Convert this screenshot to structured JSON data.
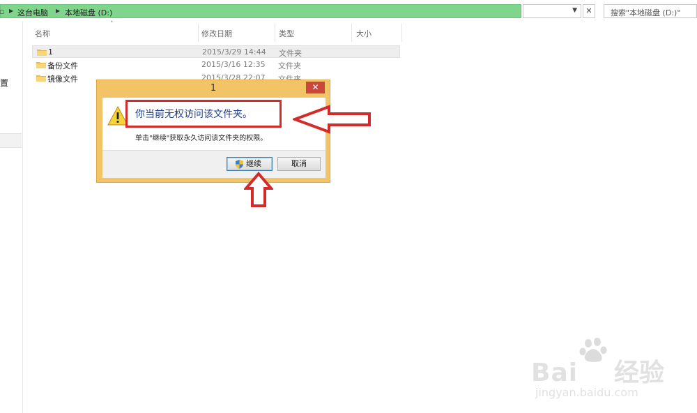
{
  "address": {
    "crumbs": [
      "这台电脑",
      "本地磁盘 (D:)"
    ]
  },
  "search": {
    "placeholder": "搜索\"本地磁盘 (D:)\""
  },
  "left_pane": {
    "partial_label": "置"
  },
  "columns": {
    "name": "名称",
    "modified": "修改日期",
    "type": "类型",
    "size": "大小"
  },
  "files": [
    {
      "name": "1",
      "date": "2015/3/29 14:44",
      "type": "文件夹"
    },
    {
      "name": "备份文件",
      "date": "2015/3/16 12:35",
      "type": "文件夹"
    },
    {
      "name": "镜像文件",
      "date": "2015/3/28 22:07",
      "type": "文件夹"
    }
  ],
  "dialog": {
    "title": "1",
    "main_message": "你当前无权访问该文件夹。",
    "sub_message": "单击\"继续\"获取永久访问该文件夹的权限。",
    "continue_label": "继续",
    "cancel_label": "取消"
  },
  "watermark": {
    "brand": "Baidu经验",
    "url": "jingyan.baidu.com"
  },
  "colors": {
    "address_bar": "#7fd58b",
    "dialog_frame": "#f2c467",
    "annotation_red": "#d42a2a",
    "message_blue": "#1f3f8f"
  }
}
